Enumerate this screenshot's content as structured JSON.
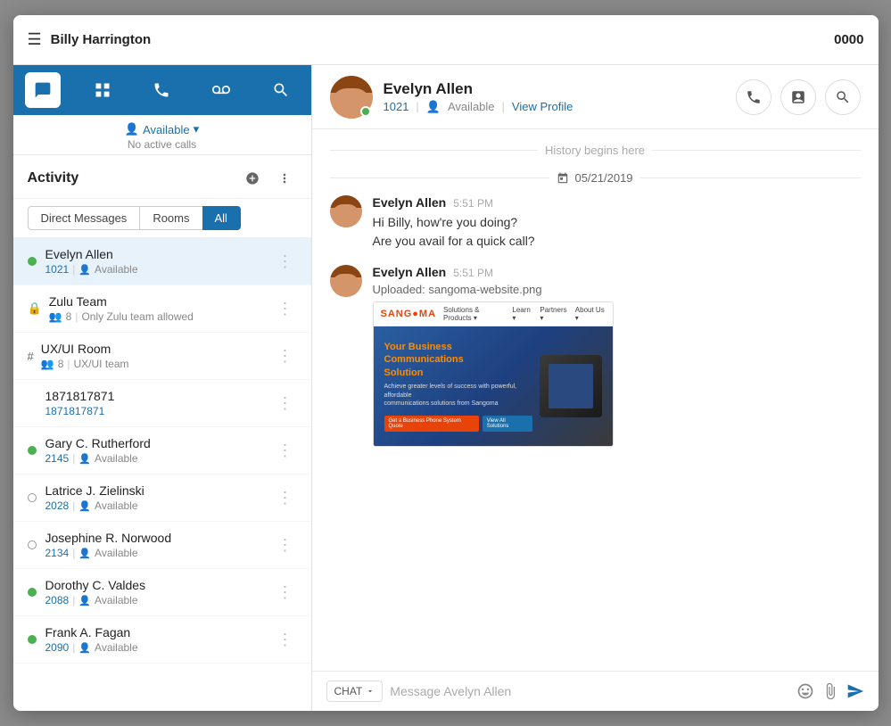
{
  "window": {
    "title": "Billy Harrington",
    "extension": "0000"
  },
  "user": {
    "status": "Available",
    "no_calls": "No active calls"
  },
  "sidebar": {
    "nav_icons": [
      "chat",
      "grid",
      "phone",
      "voicemail",
      "search"
    ],
    "title": "Activity",
    "filter_tabs": [
      "Direct Messages",
      "Rooms",
      "All"
    ],
    "active_tab": "All",
    "contacts": [
      {
        "id": 1,
        "name": "Evelyn Allen",
        "ext": "1021",
        "status": "Available",
        "status_type": "online",
        "type": "dm"
      },
      {
        "id": 2,
        "name": "Zulu Team",
        "ext": "",
        "member_count": "8",
        "desc": "Only Zulu team allowed",
        "status_type": "lock",
        "type": "room"
      },
      {
        "id": 3,
        "name": "UX/UI Room",
        "ext": "",
        "member_count": "8",
        "desc": "UX/UI team",
        "status_type": "hash",
        "type": "room"
      },
      {
        "id": 4,
        "name": "1871817871",
        "ext": "1871817871",
        "status": "",
        "status_type": "none",
        "type": "number"
      },
      {
        "id": 5,
        "name": "Gary C. Rutherford",
        "ext": "2145",
        "status": "Available",
        "status_type": "online",
        "type": "dm"
      },
      {
        "id": 6,
        "name": "Latrice J. Zielinski",
        "ext": "2028",
        "status": "Available",
        "status_type": "hollow",
        "type": "dm"
      },
      {
        "id": 7,
        "name": "Josephine R. Norwood",
        "ext": "2134",
        "status": "Available",
        "status_type": "hollow",
        "type": "dm"
      },
      {
        "id": 8,
        "name": "Dorothy C. Valdes",
        "ext": "2088",
        "status": "Available",
        "status_type": "online",
        "type": "dm"
      },
      {
        "id": 9,
        "name": "Frank A. Fagan",
        "ext": "2090",
        "status": "Available",
        "status_type": "online",
        "type": "dm"
      }
    ]
  },
  "chat": {
    "contact_name": "Evelyn Allen",
    "contact_ext": "1021",
    "contact_status": "Available",
    "view_profile": "View Profile",
    "history_label": "History begins here",
    "date_label": "05/21/2019",
    "messages": [
      {
        "id": 1,
        "sender": "Evelyn Allen",
        "time": "5:51",
        "ampm": "PM",
        "lines": [
          "Hi Billy, how're you doing?",
          "Are you avail for a quick call?"
        ],
        "has_image": false
      },
      {
        "id": 2,
        "sender": "Evelyn Allen",
        "time": "5:51",
        "ampm": "PM",
        "uploaded": "Uploaded: sangoma-website.png",
        "has_image": true
      }
    ],
    "input_placeholder": "Message Avelyn Allen",
    "chat_type": "CHAT"
  }
}
